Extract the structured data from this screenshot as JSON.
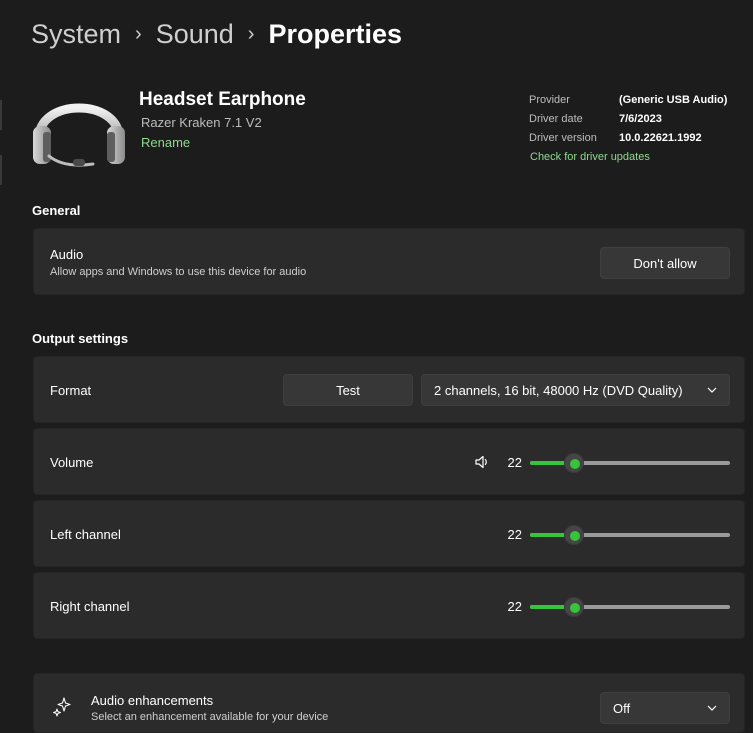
{
  "breadcrumb": {
    "level1": "System",
    "level2": "Sound",
    "current": "Properties"
  },
  "device": {
    "name": "Headset Earphone",
    "model": "Razer Kraken 7.1 V2",
    "rename_label": "Rename",
    "icon": "headset-icon",
    "info": {
      "provider_label": "Provider",
      "provider_value": "(Generic USB Audio)",
      "date_label": "Driver date",
      "date_value": "7/6/2023",
      "version_label": "Driver version",
      "version_value": "10.0.22621.1992",
      "update_link": "Check for driver updates"
    }
  },
  "general": {
    "header": "General",
    "audio": {
      "title": "Audio",
      "description": "Allow apps and Windows to use this device for audio",
      "button": "Don't allow"
    }
  },
  "output": {
    "header": "Output settings",
    "format": {
      "label": "Format",
      "test_button": "Test",
      "selected": "2 channels, 16 bit, 48000 Hz (DVD Quality)"
    },
    "volume": {
      "label": "Volume",
      "value": "22",
      "level": 0.22,
      "icon": "speaker-icon"
    },
    "left": {
      "label": "Left channel",
      "value": "22",
      "level": 0.22
    },
    "right": {
      "label": "Right channel",
      "value": "22",
      "level": 0.22
    }
  },
  "enhancements": {
    "title": "Audio enhancements",
    "description": "Select an enhancement available for your device",
    "selected": "Off",
    "icon": "sparkle-icon"
  },
  "colors": {
    "accent": "#36c43a",
    "link": "#8fd98f",
    "background": "#1c1c1c",
    "card": "#2b2b2b"
  }
}
